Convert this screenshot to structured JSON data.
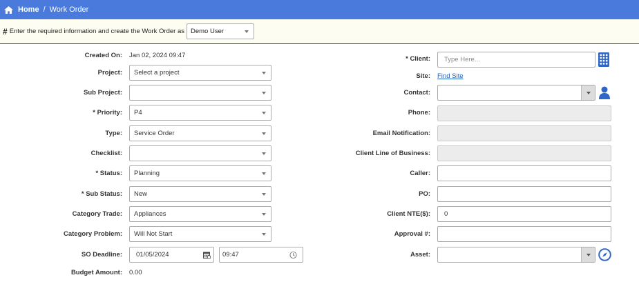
{
  "breadcrumb": {
    "home": "Home",
    "separator": "/",
    "current": "Work Order"
  },
  "infobar": {
    "hash": "#",
    "text": "Enter the required information and create the Work Order as",
    "user": "Demo User"
  },
  "left": {
    "created_on_label": "Created On:",
    "created_on_value": "Jan 02, 2024 09:47",
    "project_label": "Project:",
    "project_value": "Select a project",
    "sub_project_label": "Sub Project:",
    "sub_project_value": "",
    "priority_label": "* Priority:",
    "priority_value": "P4",
    "type_label": "Type:",
    "type_value": "Service Order",
    "checklist_label": "Checklist:",
    "checklist_value": "",
    "status_label": "* Status:",
    "status_value": "Planning",
    "sub_status_label": "* Sub Status:",
    "sub_status_value": "New",
    "category_trade_label": "Category Trade:",
    "category_trade_value": "Appliances",
    "category_problem_label": "Category Problem:",
    "category_problem_value": "Will Not Start",
    "so_deadline_label": "SO Deadline:",
    "so_deadline_date": "01/05/2024",
    "so_deadline_time": "09:47",
    "budget_label": "Budget Amount:",
    "budget_value": "0.00"
  },
  "right": {
    "client_label": "* Client:",
    "client_placeholder": "Type Here...",
    "site_label": "Site:",
    "site_link": "Find Site",
    "contact_label": "Contact:",
    "contact_value": "",
    "phone_label": "Phone:",
    "email_label": "Email Notification:",
    "clob_label": "Client Line of Business:",
    "caller_label": "Caller:",
    "caller_value": "",
    "po_label": "PO:",
    "po_value": "",
    "nte_label": "Client NTE($):",
    "nte_value": "0",
    "approval_label": "Approval #:",
    "approval_value": "",
    "asset_label": "Asset:",
    "asset_value": ""
  },
  "colors": {
    "topbar": "#4a7bdc",
    "infobar_bg": "#fdfdf1",
    "link": "#1a5fc5",
    "icon_blue": "#2f66c9"
  }
}
